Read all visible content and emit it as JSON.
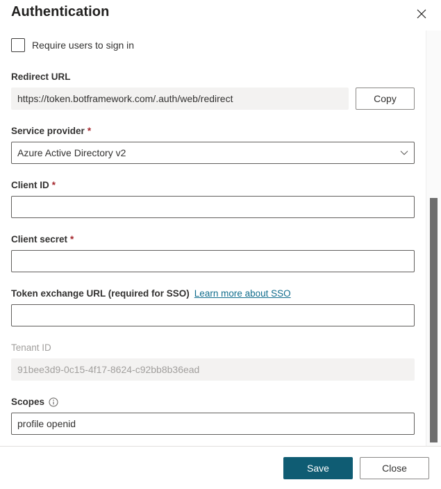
{
  "panel": {
    "title": "Authentication",
    "close_icon": "close-icon"
  },
  "require_signin": {
    "label": "Require users to sign in",
    "checked": false
  },
  "redirect_url": {
    "label": "Redirect URL",
    "value": "https://token.botframework.com/.auth/web/redirect",
    "copy_label": "Copy"
  },
  "service_provider": {
    "label": "Service provider",
    "required_marker": "*",
    "value": "Azure Active Directory v2",
    "chevron_icon": "chevron-down-icon"
  },
  "client_id": {
    "label": "Client ID",
    "required_marker": "*",
    "value": "",
    "placeholder": ""
  },
  "client_secret": {
    "label": "Client secret",
    "required_marker": "*",
    "value": "",
    "placeholder": ""
  },
  "token_exchange_url": {
    "label": "Token exchange URL (required for SSO)",
    "link_text": "Learn more about SSO",
    "value": "",
    "placeholder": ""
  },
  "tenant_id": {
    "label": "Tenant ID",
    "value": "91bee3d9-0c15-4f17-8624-c92bb8b36ead"
  },
  "scopes": {
    "label": "Scopes",
    "info_icon": "info-circle-icon",
    "value": "profile openid",
    "placeholder": ""
  },
  "footer": {
    "save_label": "Save",
    "close_label": "Close"
  },
  "colors": {
    "primary": "#0f5c73",
    "link": "#0f6c8c",
    "required": "#a4262c",
    "text": "#323130",
    "disabled_text": "#a19f9d",
    "field_bg_readonly": "#f3f2f1",
    "border": "#605e5c",
    "scroll_thumb": "#6e6e6e"
  }
}
